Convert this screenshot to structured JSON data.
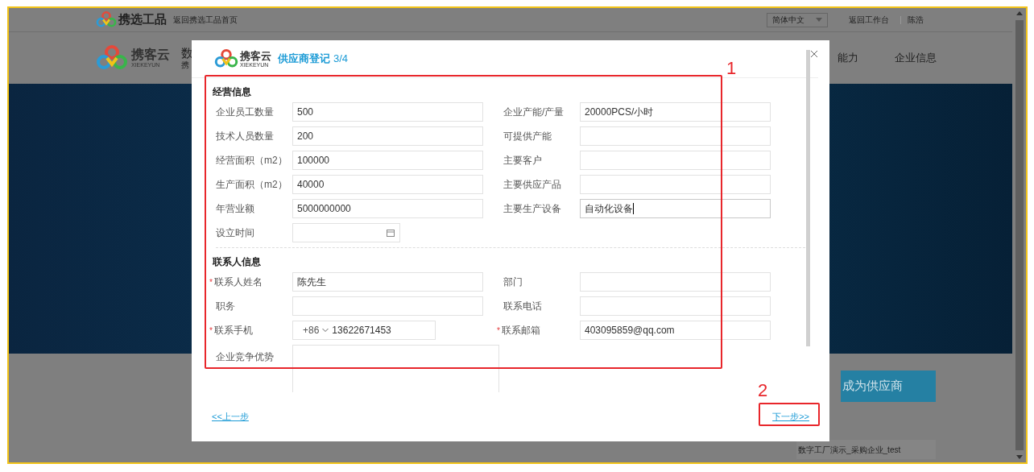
{
  "page": {
    "brand": "携选工品",
    "back_link": "返回携选工品首页",
    "language": "简体中文",
    "workbench_link": "返回工作台",
    "user": "陈浩",
    "logo_text": "携客云",
    "logo_subtext": "XIEKEYUN",
    "nav_title_partial": "数",
    "nav_subtitle_partial": "携",
    "nav_items": [
      "能力",
      "企业信息"
    ],
    "cta_button": "成为供应商",
    "company_item": "数字工厂演示_采购企业_test"
  },
  "dialog": {
    "logo_text": "携客云",
    "logo_subtext": "XIEKEYUN",
    "title": "供应商登记",
    "step": "3/4",
    "sections": [
      {
        "title": "经营信息",
        "fields": [
          {
            "kind": "text",
            "label": "企业员工数量",
            "value": "500",
            "required": false,
            "focused": false
          },
          {
            "kind": "text",
            "label": "企业产能/产量",
            "value": "20000PCS/小时",
            "required": false,
            "focused": false
          },
          {
            "kind": "text",
            "label": "技术人员数量",
            "value": "200",
            "required": false,
            "focused": false
          },
          {
            "kind": "text",
            "label": "可提供产能",
            "required": false,
            "focused": false
          },
          {
            "kind": "text",
            "label": "经营面积（m2）",
            "value": "100000",
            "required": false,
            "focused": false
          },
          {
            "kind": "text",
            "label": "主要客户",
            "required": false,
            "focused": false
          },
          {
            "kind": "text",
            "label": "生产面积（m2）",
            "value": "40000",
            "required": false,
            "focused": false
          },
          {
            "kind": "text",
            "label": "主要供应产品",
            "required": false,
            "focused": false
          },
          {
            "kind": "text",
            "label": "年营业额",
            "value": "5000000000",
            "required": false,
            "focused": false
          },
          {
            "kind": "text",
            "label": "主要生产设备",
            "value": "自动化设备",
            "required": false,
            "focused": true
          },
          {
            "kind": "date",
            "label": "设立时间",
            "required": false,
            "focused": false
          }
        ]
      },
      {
        "title": "联系人信息",
        "fields": [
          {
            "kind": "text",
            "label": "联系人姓名",
            "value": "陈先生",
            "required_mark": "*",
            "required": true,
            "focused": false
          },
          {
            "kind": "text",
            "label": "部门",
            "required": false,
            "focused": false
          },
          {
            "kind": "text",
            "label": "职务",
            "required": false,
            "focused": false
          },
          {
            "kind": "text",
            "label": "联系电话",
            "required": false,
            "focused": false
          },
          {
            "kind": "phone",
            "label": "联系手机",
            "country_code": "+86",
            "value": "13622671453",
            "required_mark": "*",
            "required": true,
            "focused": false
          },
          {
            "kind": "text",
            "label": "联系邮箱",
            "value": "403095859@qq.com",
            "required_mark": "*",
            "required": true,
            "focused": false
          },
          {
            "kind": "textarea",
            "label": "企业竞争优势",
            "required": false,
            "focused": false
          }
        ]
      }
    ],
    "prev_link": "<<上一步",
    "next_link": "下一步>>",
    "annotation_form": "1",
    "annotation_next": "2"
  }
}
